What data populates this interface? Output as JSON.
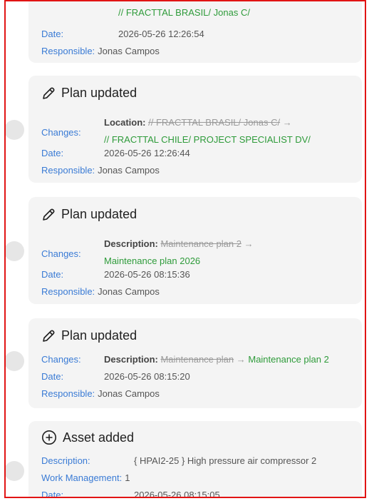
{
  "entries": [
    {
      "partial_top_text": "// FRACTTAL BRASIL/ Jonas C/",
      "date_label": "Date:",
      "date": "2026-05-26 12:26:54",
      "responsible_label": "Responsible:",
      "responsible": "Jonas Campos"
    },
    {
      "title": "Plan updated",
      "icon": "pencil-icon",
      "changes_label": "Changes:",
      "field": "Location:",
      "old": "// FRACTTAL BRASIL/ Jonas C/",
      "arrow": "→",
      "new": "// FRACTTAL CHILE/ PROJECT SPECIALIST DV/",
      "date_label": "Date:",
      "date": "2026-05-26 12:26:44",
      "responsible_label": "Responsible:",
      "responsible": "Jonas Campos"
    },
    {
      "title": "Plan updated",
      "icon": "pencil-icon",
      "changes_label": "Changes:",
      "field": "Description:",
      "old": "Maintenance plan 2",
      "arrow": "→",
      "new": "Maintenance plan 2026",
      "date_label": "Date:",
      "date": "2026-05-26 08:15:36",
      "responsible_label": "Responsible:",
      "responsible": "Jonas Campos"
    },
    {
      "title": "Plan updated",
      "icon": "pencil-icon",
      "changes_label": "Changes:",
      "field": "Description:",
      "old": "Maintenance plan",
      "arrow": "→",
      "new": "Maintenance plan 2",
      "date_label": "Date:",
      "date": "2026-05-26 08:15:20",
      "responsible_label": "Responsible:",
      "responsible": "Jonas Campos"
    },
    {
      "title": "Asset added",
      "icon": "plus-circle-icon",
      "description_label": "Description:",
      "description": "{ HPAI2-25 } High pressure air compressor 2",
      "work_label": "Work Management:",
      "work": "1",
      "date_label": "Date:",
      "date": "2026-05-26 08:15:05"
    }
  ],
  "colors": {
    "label": "#3a7bd5",
    "new_value": "#2e9b3a",
    "old_value": "#9a9a9a",
    "card_bg": "#f4f4f4",
    "border": "#e11414"
  }
}
